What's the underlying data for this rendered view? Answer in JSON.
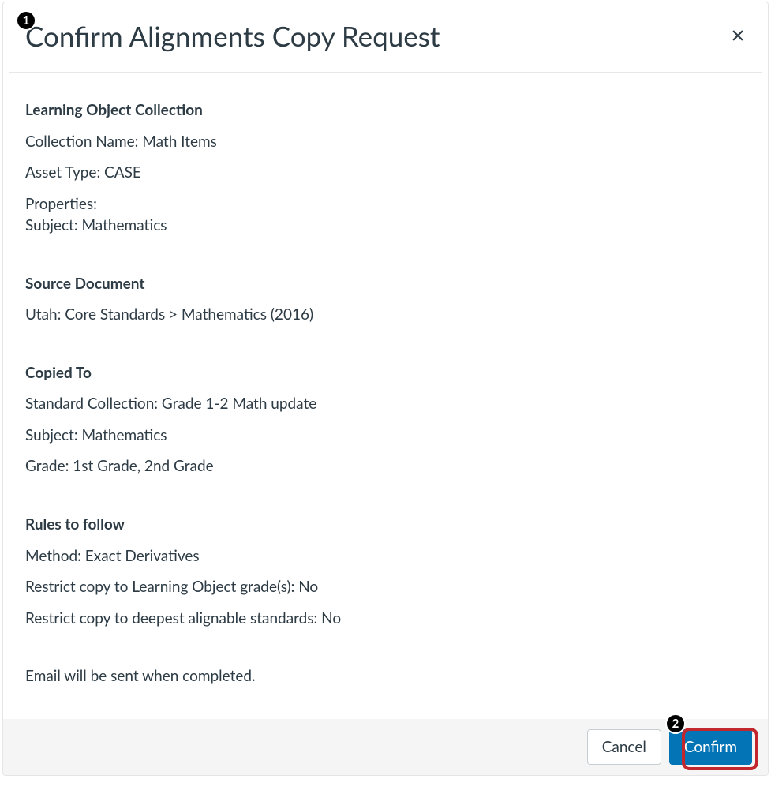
{
  "modal": {
    "title": "Confirm Alignments Copy Request",
    "sections": {
      "collection": {
        "title": "Learning Object Collection",
        "collection_name": "Collection Name: Math Items",
        "asset_type": "Asset Type: CASE",
        "properties_label": "Properties:",
        "subject": "Subject: Mathematics"
      },
      "source": {
        "title": "Source Document",
        "value": "Utah: Core Standards > Mathematics (2016)"
      },
      "copied_to": {
        "title": "Copied To",
        "standard_collection": "Standard Collection: Grade 1-2 Math update",
        "subject": "Subject: Mathematics",
        "grade": "Grade: 1st Grade, 2nd Grade"
      },
      "rules": {
        "title": "Rules to follow",
        "method": "Method: Exact Derivatives",
        "restrict_grade": "Restrict copy to Learning Object grade(s): No",
        "restrict_deepest": "Restrict copy to deepest alignable standards: No"
      }
    },
    "note": "Email will be sent when completed.",
    "buttons": {
      "cancel": "Cancel",
      "confirm": "Confirm"
    }
  },
  "annotations": {
    "badge1": "1",
    "badge2": "2"
  }
}
